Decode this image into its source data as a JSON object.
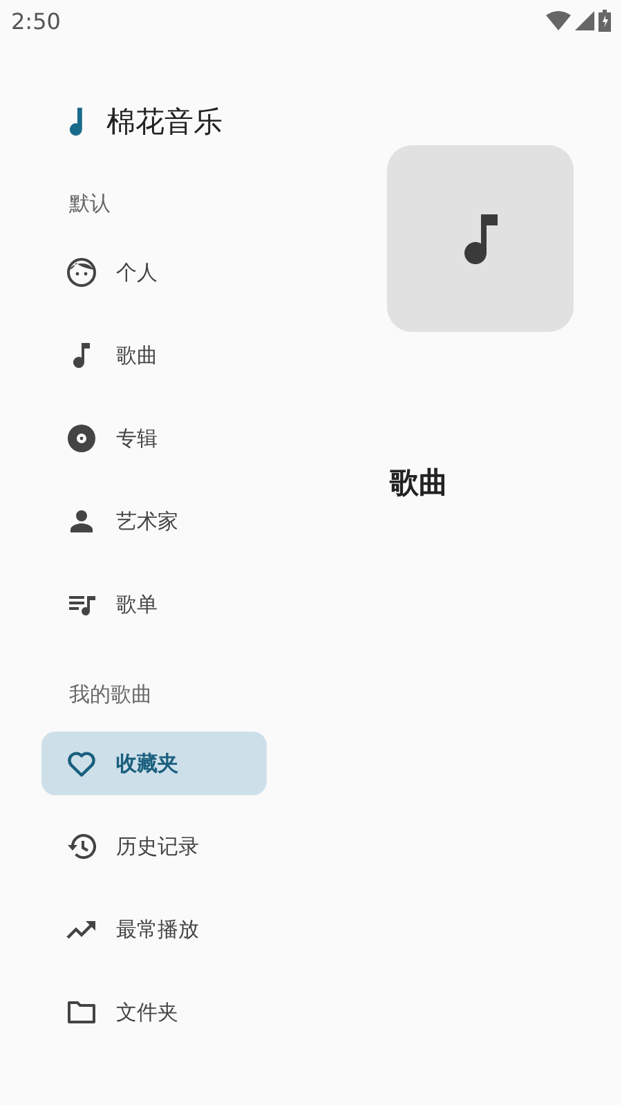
{
  "status_bar": {
    "time": "2:50"
  },
  "app_title": "棉花音乐",
  "sections": [
    {
      "title": "默认",
      "items": [
        {
          "label": "个人",
          "kind": "face",
          "selected": false
        },
        {
          "label": "歌曲",
          "kind": "note",
          "selected": false
        },
        {
          "label": "专辑",
          "kind": "disc",
          "selected": false
        },
        {
          "label": "艺术家",
          "kind": "person",
          "selected": false
        },
        {
          "label": "歌单",
          "kind": "playlist",
          "selected": false
        }
      ]
    },
    {
      "title": "我的歌曲",
      "items": [
        {
          "label": "收藏夹",
          "kind": "heart",
          "selected": true
        },
        {
          "label": "历史记录",
          "kind": "history",
          "selected": false
        },
        {
          "label": "最常播放",
          "kind": "trending",
          "selected": false
        },
        {
          "label": "文件夹",
          "kind": "folder",
          "selected": false
        }
      ]
    }
  ],
  "content": {
    "title": "歌曲"
  }
}
